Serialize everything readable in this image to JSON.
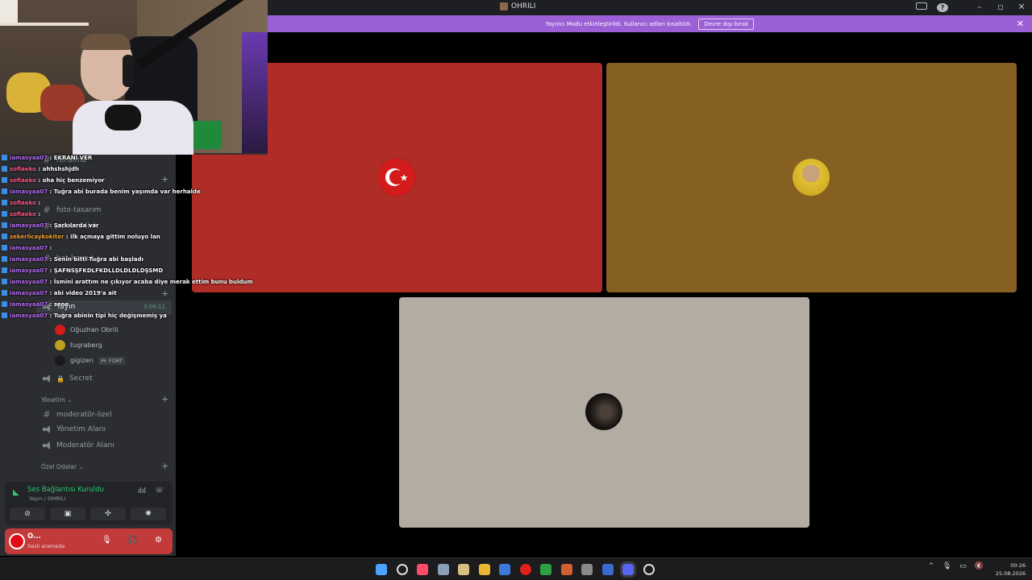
{
  "window": {
    "title": "OHRILI"
  },
  "banner": {
    "text": "Yayıncı Modu etkinleştirildi. Kullanıcı adları kısaltıldı.",
    "button": "Devre dışı bırak"
  },
  "sidebar": {
    "channels": {
      "rol_alma": "rol-alma",
      "foto": "foto-tasarım",
      "link": "sunucu-link",
      "bot": "bot-komut",
      "yayin": "Yayın",
      "secret": "Secret",
      "mod_ozel": "moderatör-özel",
      "yonetim_alani": "Yönetim Alanı",
      "moderator_alani": "Moderatör Alanı"
    },
    "categories": {
      "yonetim": "Yönetim",
      "ozel": "Özel Odalar"
    },
    "yayin_time": "3:09:11",
    "voice_users": [
      {
        "name": "Oğuzhan Obrili",
        "color": "#c23a3a"
      },
      {
        "name": "tugraberg",
        "color": "#b09020"
      },
      {
        "name": "gigizen",
        "color": "#2b2b2b",
        "tag": "FORT"
      }
    ]
  },
  "voice_panel": {
    "status": "Ses Bağlantısı Kuruldu",
    "sub": "Yayın / OHRILI"
  },
  "user_panel": {
    "name": "O...",
    "status": "Sesli aramada"
  },
  "chat": [
    {
      "user": "iamasyaa07",
      "text": "EKRANI VER",
      "color": "#b66bf0"
    },
    {
      "user": "sofiaeko",
      "text": "ahhshshjdh",
      "color": "#ff5a8a"
    },
    {
      "user": "sofiaeko",
      "text": "oha hiç benzemiyor",
      "color": "#ff5a8a"
    },
    {
      "user": "iamasyaa07",
      "text": "Tuğra abi burada benim yaşımda var herhalde",
      "color": "#b66bf0"
    },
    {
      "user": "sofiaeko",
      "text": "",
      "color": "#ff5a8a"
    },
    {
      "user": "sofiaeko",
      "text": "",
      "color": "#ff5a8a"
    },
    {
      "user": "iamasyaa07",
      "text": "Şarkılarda var",
      "color": "#b66bf0"
    },
    {
      "user": "sekerlicaykokiter",
      "text": "ilk açmaya gittim noluyo lan",
      "color": "#f0a030"
    },
    {
      "user": "iamasyaa07",
      "text": "",
      "color": "#b66bf0"
    },
    {
      "user": "iamasyaa07",
      "text": "Senin bitti Tuğra abi başladı",
      "color": "#b66bf0"
    },
    {
      "user": "iamasyaa07",
      "text": "ŞAFNSŞFKDLFKDLLDLDLDLDŞSMD",
      "color": "#b66bf0"
    },
    {
      "user": "iamasyaa07",
      "text": "İsmini arattım ne çıkıyor acaba diye merak ettim bunu buldum",
      "color": "#b66bf0"
    },
    {
      "user": "iamasyaa07",
      "text": "abi video 2019'a ait",
      "color": "#b66bf0"
    },
    {
      "user": "iamasyaa07",
      "text": "sene",
      "color": "#b66bf0"
    },
    {
      "user": "iamasyaa07",
      "text": "Tuğra abinin tipi hiç değişmemiş ya",
      "color": "#b66bf0"
    }
  ],
  "clock": {
    "time": "00:26",
    "date": "25.08.2026"
  },
  "taskbar_icons": [
    "windows-icon",
    "search-icon",
    "music-icon",
    "settings-icon",
    "notes-icon",
    "folder-icon",
    "mail-icon",
    "opera-icon",
    "xbox-icon",
    "news-icon",
    "calendar-icon",
    "steam-icon",
    "discord-icon",
    "chrome-icon"
  ]
}
